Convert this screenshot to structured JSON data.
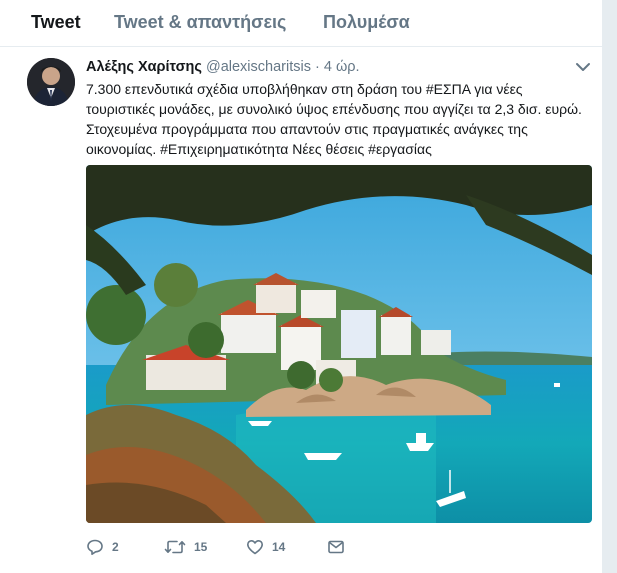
{
  "tabs": [
    {
      "label": "Tweet"
    },
    {
      "label": "Tweet & απαντήσεις"
    },
    {
      "label": "Πολυμέσα"
    }
  ],
  "tweet": {
    "author_name": "Αλέξης Χαρίτσης",
    "handle": "@alexischaritsis",
    "separator": "·",
    "time": "4 ώρ.",
    "text_lines": [
      "7.300 επενδυτικά σχέδια υποβλήθηκαν στη δράση του #ΕΣΠΑ για νέες",
      "τουριστικές μονάδες, με συνολικό ύψος επένδυσης που αγγίζει τα 2,3 δισ. ευρώ.",
      "Στοχευμένα προγράμματα που απαντούν στις πραγματικές ανάγκες της",
      "οικονομίας. #Επιχειρηματικότητα Νέες θέσεις #εργασίας"
    ],
    "reply_count": "2",
    "retweet_count": "15",
    "like_count": "14"
  },
  "colors": {
    "text_primary": "#14171a",
    "text_secondary": "#657786",
    "background": "#e6ecf0"
  },
  "icons": [
    "chevron-down-icon",
    "reply-icon",
    "retweet-icon",
    "like-icon",
    "message-icon"
  ]
}
